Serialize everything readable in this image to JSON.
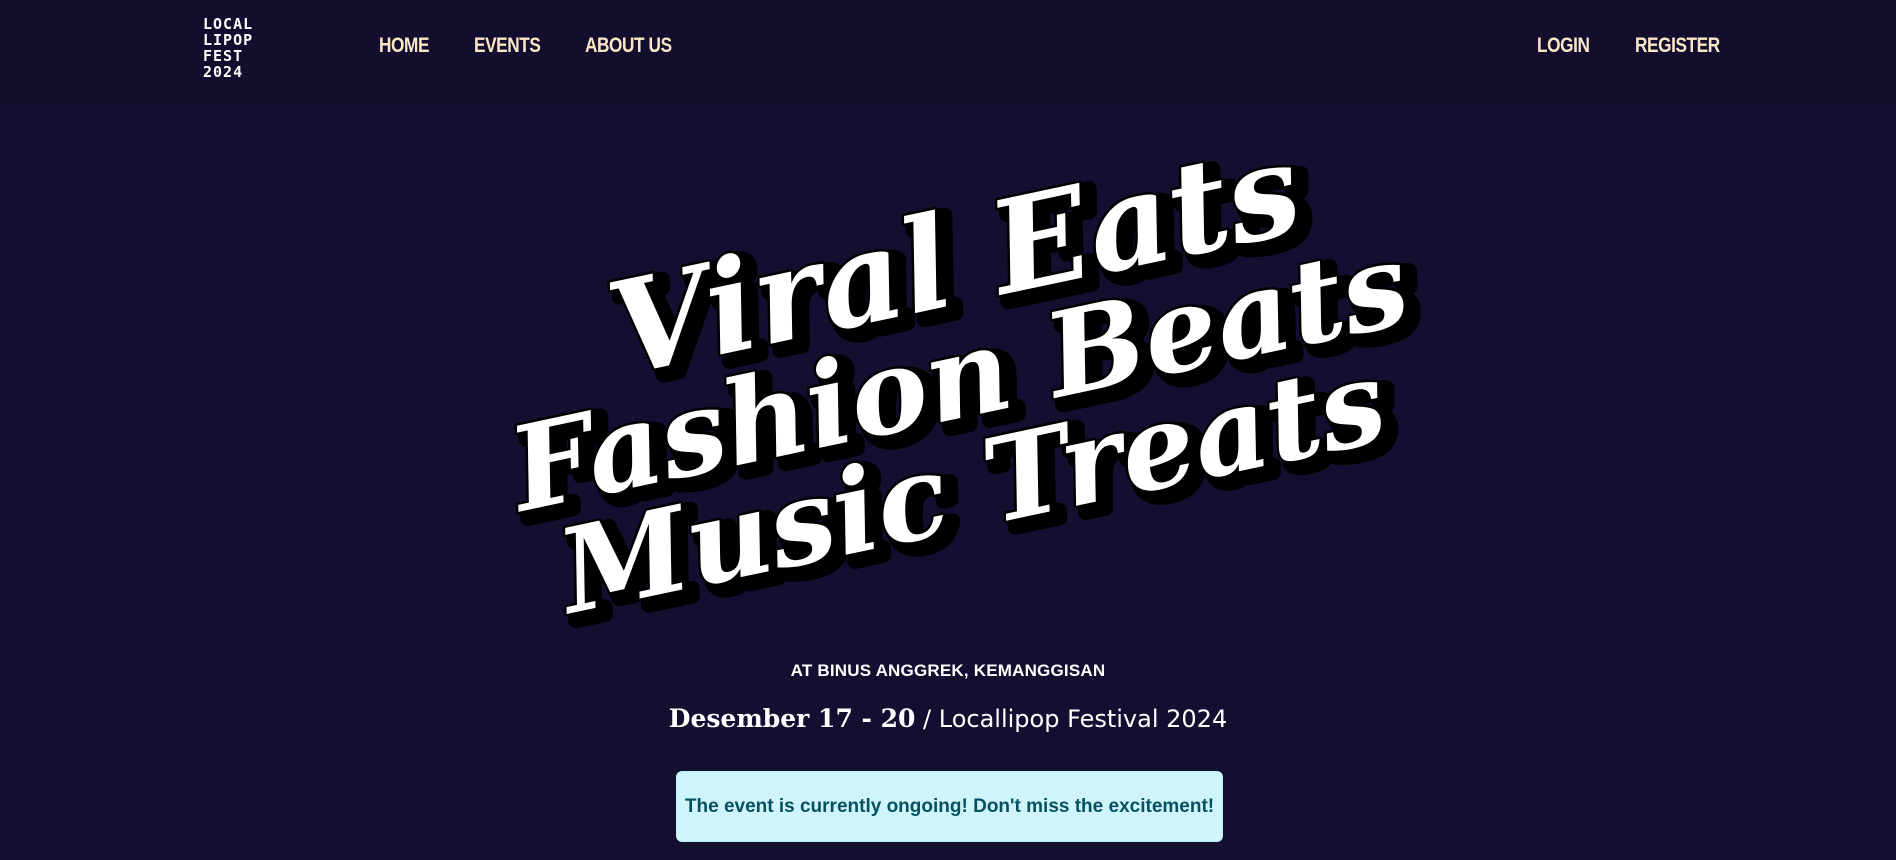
{
  "logo": {
    "lines": [
      "LOCAL",
      "LIPOP",
      "FEST",
      "2024"
    ]
  },
  "nav": {
    "home": "HOME",
    "events": "EVENTS",
    "about": "ABOUT US",
    "login": "LOGIN",
    "register": "REGISTER"
  },
  "hero": {
    "lines": [
      "Viral Eats",
      "Fashion Beats",
      "Music Treats"
    ]
  },
  "event": {
    "venue": "AT BINUS ANGGREK, KEMANGGISAN",
    "dates": "Desember 17 - 20",
    "separator_and_name": " / Locallipop Festival 2024"
  },
  "alert": {
    "message": "The event is currently ongoing! Don't miss the excitement!"
  },
  "colors": {
    "background": "#140f30",
    "nav_link": "#fbe7c6",
    "alert_bg": "#cff4fc",
    "alert_text": "#055160"
  }
}
